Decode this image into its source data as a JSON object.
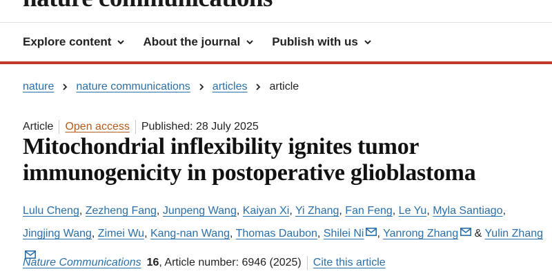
{
  "masthead": {
    "title": "nature communications"
  },
  "nav": {
    "items": [
      {
        "label": "Explore content"
      },
      {
        "label": "About the journal"
      },
      {
        "label": "Publish with us"
      }
    ]
  },
  "breadcrumb": {
    "items": [
      "nature",
      "nature communications",
      "articles"
    ],
    "current": "article"
  },
  "article": {
    "type": "Article",
    "access": "Open access",
    "published": "Published: 28 July 2025",
    "title": "Mitochondrial inflexibility ignites tumor immunogenicity in postoperative glioblastoma",
    "authors": [
      "Lulu Cheng",
      "Zezheng Fang",
      "Junpeng Wang",
      "Kaiyan Xi",
      "Yi Zhang",
      "Fan Feng",
      "Le Yu",
      "Myla Santiago",
      "Jingjing Wang",
      "Zimei Wu",
      "Kang-nan Wang",
      "Thomas Daubon",
      "Shilei Ni",
      "Yanrong Zhang",
      "Yulin Zhang"
    ],
    "author_separator": ", ",
    "author_last_joiner": "&",
    "journal": "Nature Communications",
    "volume": "16",
    "article_number": ", Article number: 6946 (2025)",
    "cite_label": "Cite this article"
  },
  "colors": {
    "accent_red": "#c0392b",
    "link_blue": "#2a6fa8",
    "open_access_orange": "#b05a1e"
  }
}
